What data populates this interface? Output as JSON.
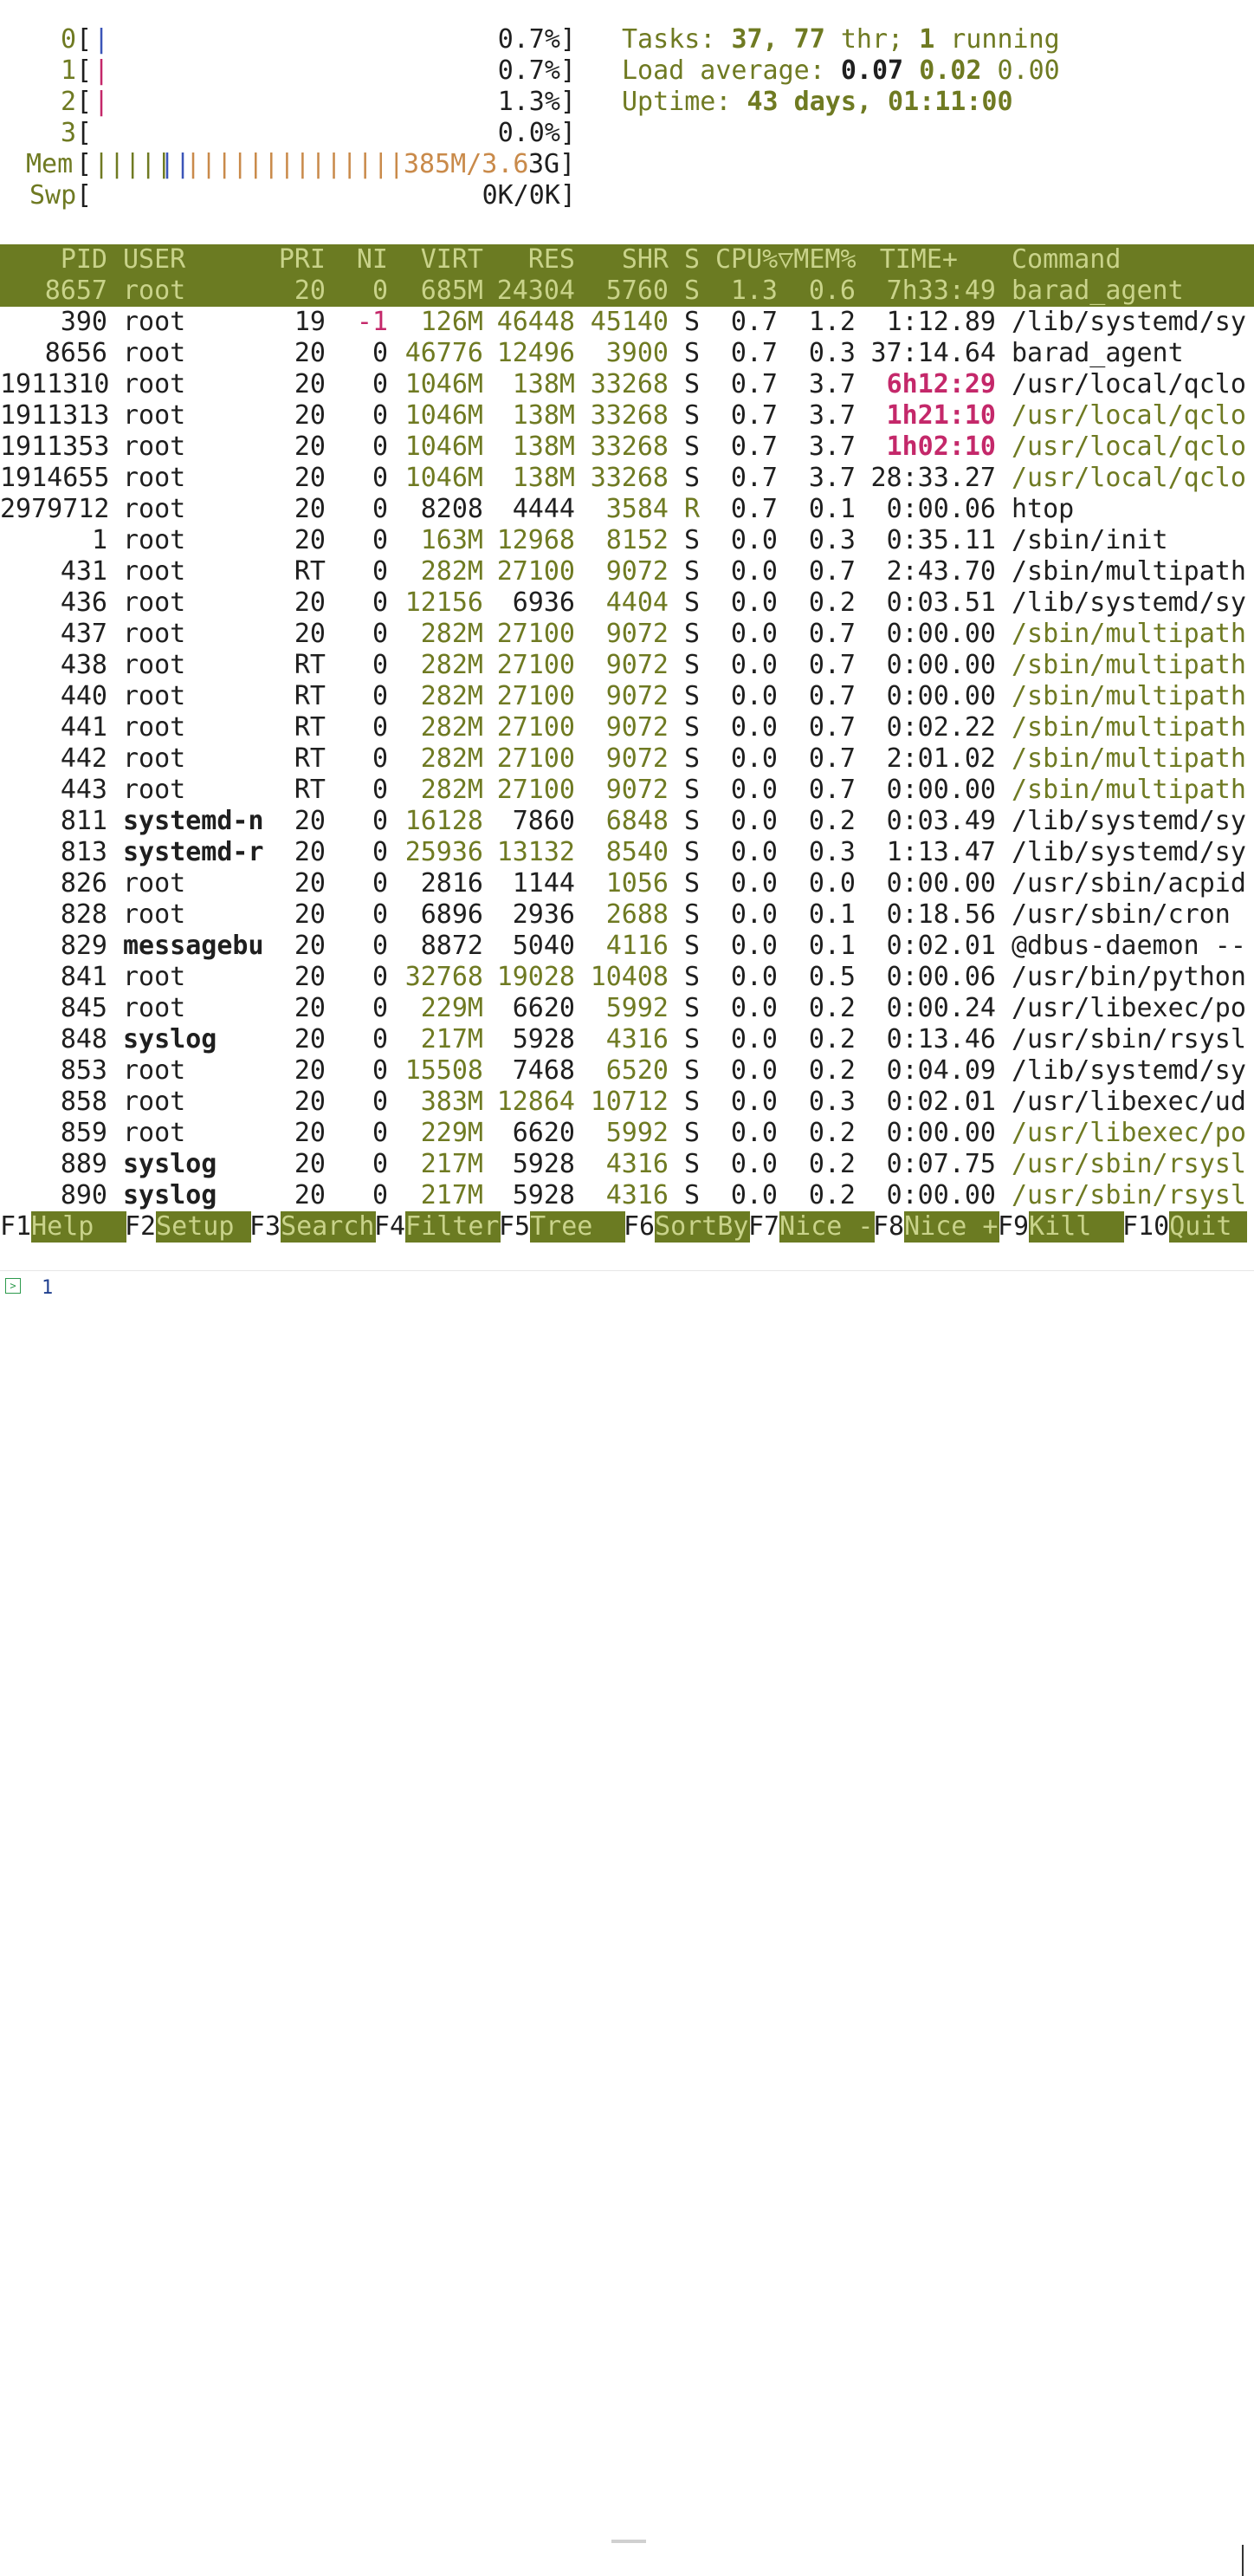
{
  "meters": {
    "cpus": [
      {
        "id": "0",
        "bars": [
          {
            "text": "|",
            "color": "blue"
          }
        ],
        "value": "0.7%]"
      },
      {
        "id": "1",
        "bars": [
          {
            "text": "|",
            "color": "mag"
          }
        ],
        "value": "0.7%]"
      },
      {
        "id": "2",
        "bars": [
          {
            "text": "|",
            "color": "mag"
          }
        ],
        "value": "1.3%]"
      },
      {
        "id": "3",
        "bars": [],
        "value": "0.0%]"
      }
    ],
    "mem": {
      "label": "Mem",
      "bars_ol": "|||||",
      "bars_blue": "||",
      "bars_org": "||||||||||||||",
      "text_org": "385M/3.6",
      "text_dark": "3G]"
    },
    "swp": {
      "label": "Swp",
      "value": "0K/0K]"
    }
  },
  "summary": {
    "tasks_label": "Tasks: ",
    "tasks_value": "37, 77",
    " thr_label": "",
    "thr_label": " thr; ",
    "running_value": "1",
    "running_label": " running",
    "load_label": "Load average: ",
    "load1": "0.07",
    "load5": "0.02",
    "load15": "0.00",
    "uptime_label": "Uptime: ",
    "uptime_value": "43 days, 01:11:00"
  },
  "columns": [
    "PID",
    "USER",
    "PRI",
    "NI",
    "VIRT",
    "RES",
    "SHR",
    "S",
    "CPU%▽MEM%",
    "TIME+",
    "Command"
  ],
  "processes": [
    {
      "pid": "8657",
      "user": "root",
      "pri": "20",
      "ni": "0",
      "virt": "685M",
      "res": "24304",
      "shr": "5760",
      "s": "S",
      "cpu": "1.3",
      "mem": "0.6",
      "time": "7h33:49",
      "cmd": "barad_agent",
      "selected": true
    },
    {
      "pid": "390",
      "user": "root",
      "pri": "19",
      "ni": "-1",
      "virt": "126M",
      "res": "46448",
      "shr": "45140",
      "s": "S",
      "cpu": "0.7",
      "mem": "1.2",
      "time": "1:12.89",
      "cmd": "/lib/systemd/sy"
    },
    {
      "pid": "8656",
      "user": "root",
      "pri": "20",
      "ni": "0",
      "virt": "46776",
      "res": "12496",
      "shr": "3900",
      "s": "S",
      "cpu": "0.7",
      "mem": "0.3",
      "time": "37:14.64",
      "cmd": "barad_agent"
    },
    {
      "pid": "1911310",
      "user": "root",
      "pri": "20",
      "ni": "0",
      "virt": "1046M",
      "res": "138M",
      "shr": "33268",
      "s": "S",
      "cpu": "0.7",
      "mem": "3.7",
      "time": "6h12:29",
      "cmd": "/usr/local/qclo"
    },
    {
      "pid": "1911313",
      "user": "root",
      "pri": "20",
      "ni": "0",
      "virt": "1046M",
      "res": "138M",
      "shr": "33268",
      "s": "S",
      "cpu": "0.7",
      "mem": "3.7",
      "time": "1h21:10",
      "cmd": "/usr/local/qclo",
      "thread": true
    },
    {
      "pid": "1911353",
      "user": "root",
      "pri": "20",
      "ni": "0",
      "virt": "1046M",
      "res": "138M",
      "shr": "33268",
      "s": "S",
      "cpu": "0.7",
      "mem": "3.7",
      "time": "1h02:10",
      "cmd": "/usr/local/qclo",
      "thread": true
    },
    {
      "pid": "1914655",
      "user": "root",
      "pri": "20",
      "ni": "0",
      "virt": "1046M",
      "res": "138M",
      "shr": "33268",
      "s": "S",
      "cpu": "0.7",
      "mem": "3.7",
      "time": "28:33.27",
      "cmd": "/usr/local/qclo",
      "thread": true
    },
    {
      "pid": "2979712",
      "user": "root",
      "pri": "20",
      "ni": "0",
      "virt": "8208",
      "res": "4444",
      "shr": "3584",
      "s": "R",
      "cpu": "0.7",
      "mem": "0.1",
      "time": "0:00.06",
      "cmd": "htop"
    },
    {
      "pid": "1",
      "user": "root",
      "pri": "20",
      "ni": "0",
      "virt": "163M",
      "res": "12968",
      "shr": "8152",
      "s": "S",
      "cpu": "0.0",
      "mem": "0.3",
      "time": "0:35.11",
      "cmd": "/sbin/init"
    },
    {
      "pid": "431",
      "user": "root",
      "pri": "RT",
      "ni": "0",
      "virt": "282M",
      "res": "27100",
      "shr": "9072",
      "s": "S",
      "cpu": "0.0",
      "mem": "0.7",
      "time": "2:43.70",
      "cmd": "/sbin/multipath"
    },
    {
      "pid": "436",
      "user": "root",
      "pri": "20",
      "ni": "0",
      "virt": "12156",
      "res": "6936",
      "shr": "4404",
      "s": "S",
      "cpu": "0.0",
      "mem": "0.2",
      "time": "0:03.51",
      "cmd": "/lib/systemd/sy"
    },
    {
      "pid": "437",
      "user": "root",
      "pri": "20",
      "ni": "0",
      "virt": "282M",
      "res": "27100",
      "shr": "9072",
      "s": "S",
      "cpu": "0.0",
      "mem": "0.7",
      "time": "0:00.00",
      "cmd": "/sbin/multipath",
      "thread": true
    },
    {
      "pid": "438",
      "user": "root",
      "pri": "RT",
      "ni": "0",
      "virt": "282M",
      "res": "27100",
      "shr": "9072",
      "s": "S",
      "cpu": "0.0",
      "mem": "0.7",
      "time": "0:00.00",
      "cmd": "/sbin/multipath",
      "thread": true
    },
    {
      "pid": "440",
      "user": "root",
      "pri": "RT",
      "ni": "0",
      "virt": "282M",
      "res": "27100",
      "shr": "9072",
      "s": "S",
      "cpu": "0.0",
      "mem": "0.7",
      "time": "0:00.00",
      "cmd": "/sbin/multipath",
      "thread": true
    },
    {
      "pid": "441",
      "user": "root",
      "pri": "RT",
      "ni": "0",
      "virt": "282M",
      "res": "27100",
      "shr": "9072",
      "s": "S",
      "cpu": "0.0",
      "mem": "0.7",
      "time": "0:02.22",
      "cmd": "/sbin/multipath",
      "thread": true
    },
    {
      "pid": "442",
      "user": "root",
      "pri": "RT",
      "ni": "0",
      "virt": "282M",
      "res": "27100",
      "shr": "9072",
      "s": "S",
      "cpu": "0.0",
      "mem": "0.7",
      "time": "2:01.02",
      "cmd": "/sbin/multipath",
      "thread": true
    },
    {
      "pid": "443",
      "user": "root",
      "pri": "RT",
      "ni": "0",
      "virt": "282M",
      "res": "27100",
      "shr": "9072",
      "s": "S",
      "cpu": "0.0",
      "mem": "0.7",
      "time": "0:00.00",
      "cmd": "/sbin/multipath",
      "thread": true
    },
    {
      "pid": "811",
      "user": "systemd-n",
      "pri": "20",
      "ni": "0",
      "virt": "16128",
      "res": "7860",
      "shr": "6848",
      "s": "S",
      "cpu": "0.0",
      "mem": "0.2",
      "time": "0:03.49",
      "cmd": "/lib/systemd/sy",
      "userBold": true
    },
    {
      "pid": "813",
      "user": "systemd-r",
      "pri": "20",
      "ni": "0",
      "virt": "25936",
      "res": "13132",
      "shr": "8540",
      "s": "S",
      "cpu": "0.0",
      "mem": "0.3",
      "time": "1:13.47",
      "cmd": "/lib/systemd/sy",
      "userBold": true
    },
    {
      "pid": "826",
      "user": "root",
      "pri": "20",
      "ni": "0",
      "virt": "2816",
      "res": "1144",
      "shr": "1056",
      "s": "S",
      "cpu": "0.0",
      "mem": "0.0",
      "time": "0:00.00",
      "cmd": "/usr/sbin/acpid"
    },
    {
      "pid": "828",
      "user": "root",
      "pri": "20",
      "ni": "0",
      "virt": "6896",
      "res": "2936",
      "shr": "2688",
      "s": "S",
      "cpu": "0.0",
      "mem": "0.1",
      "time": "0:18.56",
      "cmd": "/usr/sbin/cron"
    },
    {
      "pid": "829",
      "user": "messagebu",
      "pri": "20",
      "ni": "0",
      "virt": "8872",
      "res": "5040",
      "shr": "4116",
      "s": "S",
      "cpu": "0.0",
      "mem": "0.1",
      "time": "0:02.01",
      "cmd": "@dbus-daemon --",
      "userBold": true
    },
    {
      "pid": "841",
      "user": "root",
      "pri": "20",
      "ni": "0",
      "virt": "32768",
      "res": "19028",
      "shr": "10408",
      "s": "S",
      "cpu": "0.0",
      "mem": "0.5",
      "time": "0:00.06",
      "cmd": "/usr/bin/python"
    },
    {
      "pid": "845",
      "user": "root",
      "pri": "20",
      "ni": "0",
      "virt": "229M",
      "res": "6620",
      "shr": "5992",
      "s": "S",
      "cpu": "0.0",
      "mem": "0.2",
      "time": "0:00.24",
      "cmd": "/usr/libexec/po"
    },
    {
      "pid": "848",
      "user": "syslog",
      "pri": "20",
      "ni": "0",
      "virt": "217M",
      "res": "5928",
      "shr": "4316",
      "s": "S",
      "cpu": "0.0",
      "mem": "0.2",
      "time": "0:13.46",
      "cmd": "/usr/sbin/rsysl",
      "userBold": true
    },
    {
      "pid": "853",
      "user": "root",
      "pri": "20",
      "ni": "0",
      "virt": "15508",
      "res": "7468",
      "shr": "6520",
      "s": "S",
      "cpu": "0.0",
      "mem": "0.2",
      "time": "0:04.09",
      "cmd": "/lib/systemd/sy"
    },
    {
      "pid": "858",
      "user": "root",
      "pri": "20",
      "ni": "0",
      "virt": "383M",
      "res": "12864",
      "shr": "10712",
      "s": "S",
      "cpu": "0.0",
      "mem": "0.3",
      "time": "0:02.01",
      "cmd": "/usr/libexec/ud"
    },
    {
      "pid": "859",
      "user": "root",
      "pri": "20",
      "ni": "0",
      "virt": "229M",
      "res": "6620",
      "shr": "5992",
      "s": "S",
      "cpu": "0.0",
      "mem": "0.2",
      "time": "0:00.00",
      "cmd": "/usr/libexec/po",
      "thread": true
    },
    {
      "pid": "889",
      "user": "syslog",
      "pri": "20",
      "ni": "0",
      "virt": "217M",
      "res": "5928",
      "shr": "4316",
      "s": "S",
      "cpu": "0.0",
      "mem": "0.2",
      "time": "0:07.75",
      "cmd": "/usr/sbin/rsysl",
      "userBold": true,
      "thread": true
    },
    {
      "pid": "890",
      "user": "syslog",
      "pri": "20",
      "ni": "0",
      "virt": "217M",
      "res": "5928",
      "shr": "4316",
      "s": "S",
      "cpu": "0.0",
      "mem": "0.2",
      "time": "0:00.00",
      "cmd": "/usr/sbin/rsysl",
      "userBold": true,
      "thread": true
    }
  ],
  "function_keys": [
    {
      "key": "F1",
      "label": "Help  "
    },
    {
      "key": "F2",
      "label": "Setup "
    },
    {
      "key": "F3",
      "label": "Search"
    },
    {
      "key": "F4",
      "label": "Filter"
    },
    {
      "key": "F5",
      "label": "Tree  "
    },
    {
      "key": "F6",
      "label": "SortBy"
    },
    {
      "key": "F7",
      "label": "Nice -"
    },
    {
      "key": "F8",
      "label": "Nice +"
    },
    {
      "key": "F9",
      "label": "Kill  "
    },
    {
      "key": "F10",
      "label": "Quit  "
    }
  ],
  "prompt": {
    "text": "1"
  },
  "colors": {
    "olive": "#6f7a22",
    "header_bg": "#6b7b22",
    "blue": "#3b55b8",
    "magenta": "#c4286a",
    "orange": "#c98a4a"
  }
}
